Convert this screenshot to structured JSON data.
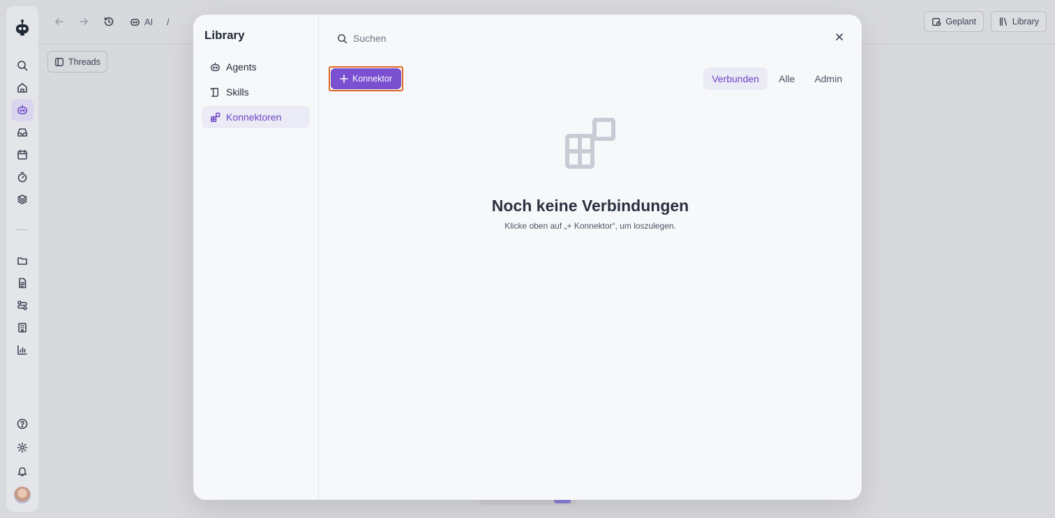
{
  "topbar": {
    "breadcrumb_ai": "AI",
    "breadcrumb_sep": "/",
    "scheduled_label": "Geplant",
    "library_label": "Library"
  },
  "threads_label": "Threads",
  "modal": {
    "title": "Library",
    "nav": [
      {
        "label": "Agents",
        "icon": "bot-icon"
      },
      {
        "label": "Skills",
        "icon": "scroll-icon"
      },
      {
        "label": "Konnektoren",
        "icon": "blocks-icon",
        "active": true
      }
    ],
    "search_placeholder": "Suchen",
    "add_button_label": "Konnektor",
    "filters": [
      {
        "label": "Verbunden",
        "active": true
      },
      {
        "label": "Alle"
      },
      {
        "label": "Admin"
      }
    ],
    "empty_title": "Noch keine Verbindungen",
    "empty_subtitle": "Klicke oben auf „+ Konnektor“, um loszulegen."
  },
  "colors": {
    "accent": "#7a4fd0",
    "accent_text": "#6b44c8",
    "highlight_border": "#e0661f"
  }
}
